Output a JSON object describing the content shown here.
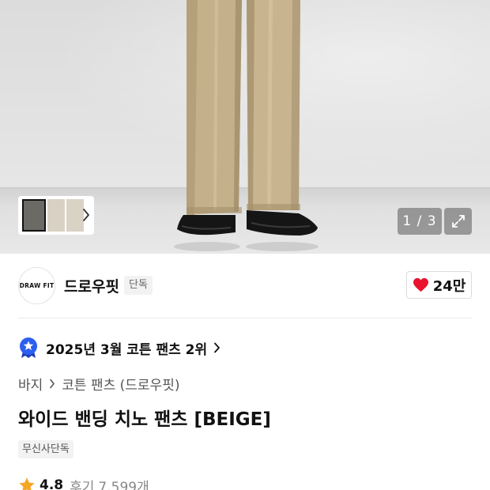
{
  "gallery": {
    "counter": "1 / 3",
    "thumbnail_count": 3
  },
  "brand": {
    "logo_text": "DRAW FIT",
    "name": "드로우핏",
    "badge": "단독",
    "likes": "24만"
  },
  "ranking": {
    "text": "2025년 3월 코튼 팬츠 2위"
  },
  "breadcrumb": {
    "items": [
      "바지",
      "코튼 팬츠 (드로우핏)"
    ]
  },
  "product": {
    "title": "와이드 밴딩 치노 팬츠 [BEIGE]",
    "tag": "무신사단독"
  },
  "rating": {
    "value": "4.8",
    "review_label": "후기",
    "review_count": "7,599개"
  },
  "icons": {
    "thumbnail_next": "chevron-right-icon",
    "expand": "expand-icon",
    "like": "heart-icon",
    "ranking": "ranking-medal-icon",
    "rating": "star-icon"
  },
  "colors": {
    "heart": "#e8132d",
    "medal": "#2c5ff0",
    "star": "#f5a623",
    "pants": "#c2ae88",
    "shoes": "#1a1a1a"
  }
}
